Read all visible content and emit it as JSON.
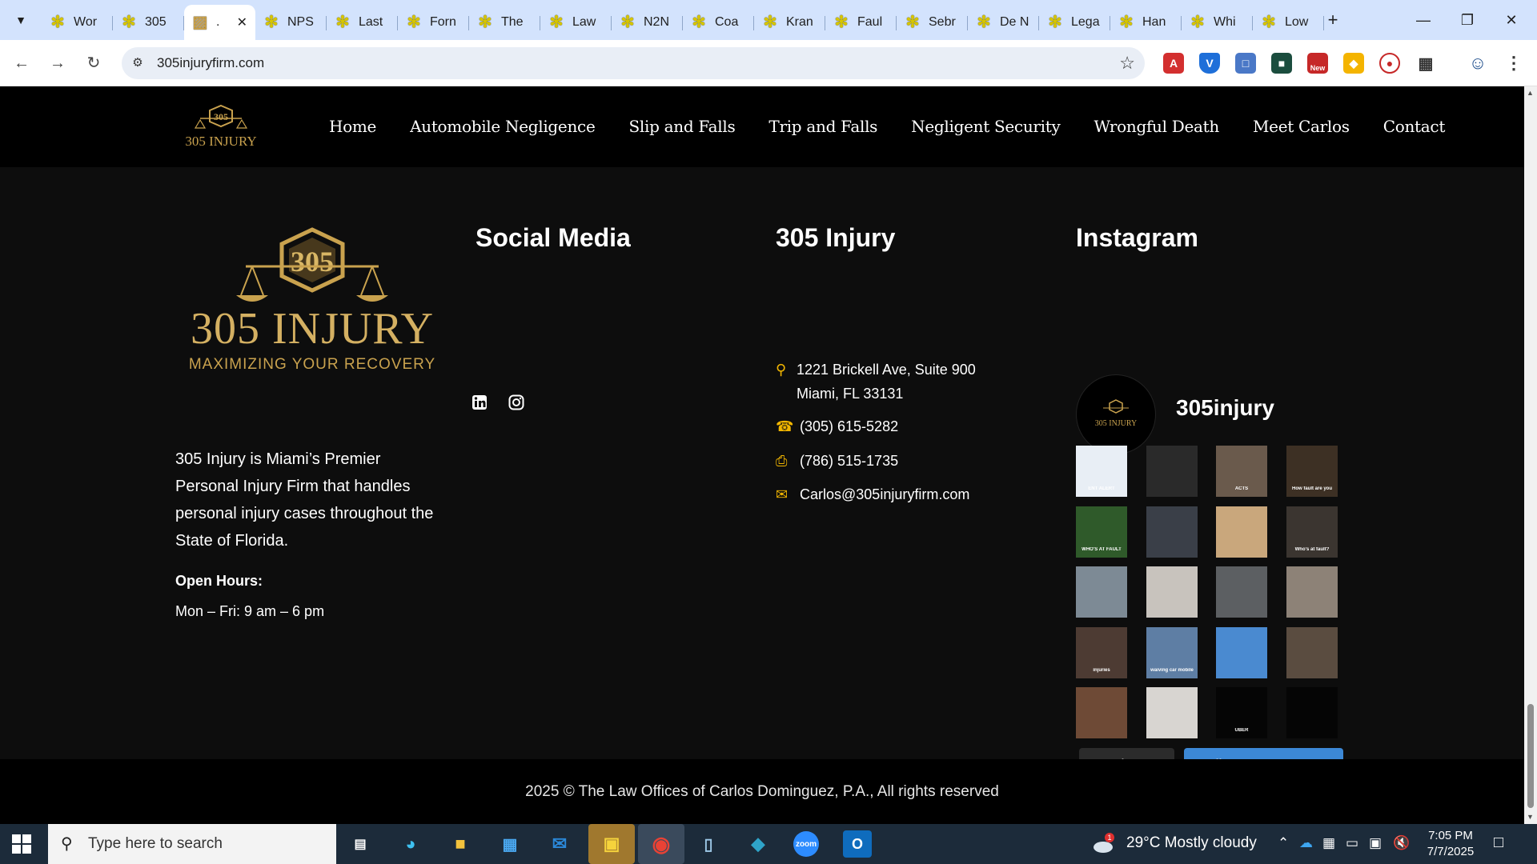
{
  "browser": {
    "tabs": [
      {
        "title": "Wor",
        "active": false
      },
      {
        "title": "305",
        "active": false
      },
      {
        "title": ".",
        "active": true
      },
      {
        "title": "NPS",
        "active": false
      },
      {
        "title": "Last",
        "active": false
      },
      {
        "title": "Forn",
        "active": false
      },
      {
        "title": "The",
        "active": false
      },
      {
        "title": "Law",
        "active": false
      },
      {
        "title": "N2N",
        "active": false
      },
      {
        "title": "Coa",
        "active": false
      },
      {
        "title": "Kran",
        "active": false
      },
      {
        "title": "Faul",
        "active": false
      },
      {
        "title": "Sebr",
        "active": false
      },
      {
        "title": "De N",
        "active": false
      },
      {
        "title": "Lega",
        "active": false
      },
      {
        "title": "Han",
        "active": false
      },
      {
        "title": "Whi",
        "active": false
      },
      {
        "title": "Low",
        "active": false
      }
    ],
    "new_tab": "+",
    "url": "305injuryfirm.com",
    "ext_new_badge": "New"
  },
  "header": {
    "nav": [
      "Home",
      "Automobile Negligence",
      "Slip and Falls",
      "Trip and Falls",
      "Negligent Security",
      "Wrongful Death",
      "Meet Carlos",
      "Contact"
    ]
  },
  "footer": {
    "about": "305 Injury is Miami’s Premier Personal Injury Firm that handles personal injury cases throughout the State of Florida.",
    "hours_label": "Open Hours:",
    "hours": "Mon – Fri: 9 am – 6 pm",
    "social_head": "Social Media",
    "contact_head": "305 Injury",
    "address_line1": "1221 Brickell Ave, Suite 900",
    "address_line2": "Miami, FL 33131",
    "phone": "(305) 615-5282",
    "fax": "(786) 515-1735",
    "email": "Carlos@305injuryfirm.com",
    "insta_head": "Instagram",
    "insta_handle": "305injury",
    "load_more": "Load More",
    "follow": "Follow on Instagram",
    "copyright": "2025 © The Law Offices of Carlos Dominguez, P.A., All rights reserved"
  },
  "instagram_thumbs": [
    {
      "color": "#e8eef5",
      "caption": "ENT ALERT"
    },
    {
      "color": "#2a2a2a",
      "caption": ""
    },
    {
      "color": "#6a5a4c",
      "caption": "ACTS"
    },
    {
      "color": "#3d3024",
      "caption": "How fault are you"
    },
    {
      "color": "#2f5a2a",
      "caption": "WHO'S AT FAULT"
    },
    {
      "color": "#3a3f48",
      "caption": ""
    },
    {
      "color": "#c9a77c",
      "caption": ""
    },
    {
      "color": "#3b3530",
      "caption": "Who's at fault?"
    },
    {
      "color": "#7d8a95",
      "caption": ""
    },
    {
      "color": "#c8c3bd",
      "caption": ""
    },
    {
      "color": "#5c5f62",
      "caption": ""
    },
    {
      "color": "#8d8277",
      "caption": ""
    },
    {
      "color": "#4d3b33",
      "caption": "injuries"
    },
    {
      "color": "#5e7ea4",
      "caption": "waiving car mobile"
    },
    {
      "color": "#4a8ad0",
      "caption": ""
    },
    {
      "color": "#5a4c40",
      "caption": ""
    },
    {
      "color": "#6e4a36",
      "caption": ""
    },
    {
      "color": "#d8d5d1",
      "caption": ""
    },
    {
      "color": "#050505",
      "caption": "UBER"
    },
    {
      "color": "#050505",
      "caption": ""
    }
  ],
  "brand": {
    "logo_number": "305",
    "logo_word": "305 INJURY",
    "logo_tagline": "MAXIMIZING YOUR RECOVERY",
    "gold": "#c9a24e",
    "accent_yellow": "#f2b600"
  },
  "taskbar": {
    "search_placeholder": "Type here to search",
    "weather_badge": "1",
    "weather": "29°C  Mostly cloudy",
    "time": "7:05 PM",
    "date": "7/7/2025"
  }
}
